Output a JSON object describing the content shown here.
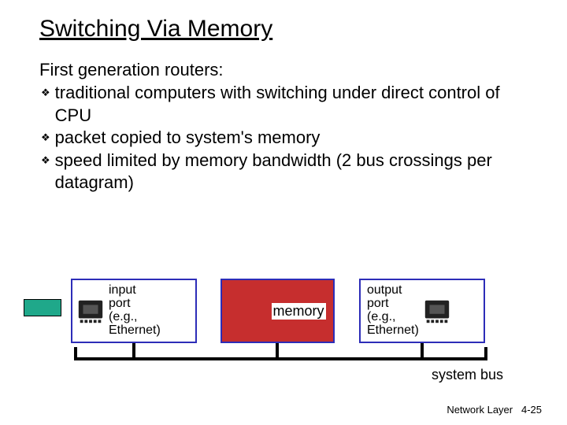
{
  "title": "Switching Via Memory",
  "subhead": "First generation routers:",
  "bullets": [
    "traditional computers with switching under direct control of CPU",
    "packet copied to system's memory",
    "speed limited by memory bandwidth (2 bus crossings per datagram)"
  ],
  "diagram": {
    "input_label": "input\nport\n(e.g.,\nEthernet)",
    "memory_label": "memory",
    "output_label": "output\nport\n(e.g.,\nEthernet)",
    "bus_label": "system bus"
  },
  "footer": {
    "label": "Network Layer",
    "page": "4-25"
  }
}
